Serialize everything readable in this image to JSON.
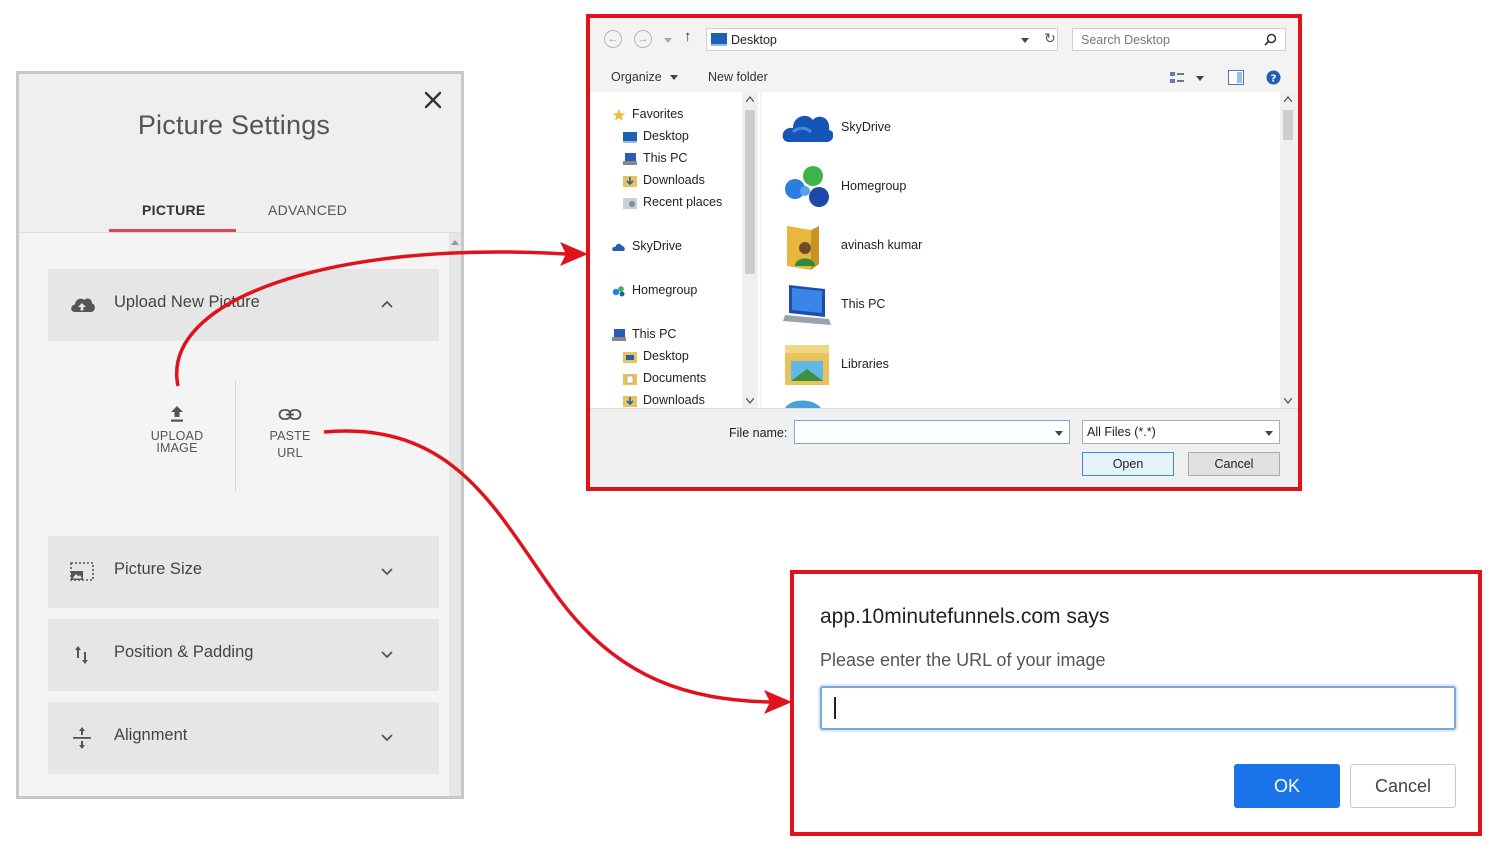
{
  "picture_settings": {
    "title": "Picture Settings",
    "tabs": [
      {
        "label": "PICTURE",
        "active": true
      },
      {
        "label": "ADVANCED",
        "active": false
      }
    ],
    "sections": [
      {
        "label": "Upload New Picture",
        "icon": "cloud-upload-icon",
        "expanded": true
      },
      {
        "label": "Picture Size",
        "icon": "picture-size-icon",
        "expanded": false
      },
      {
        "label": "Position & Padding",
        "icon": "position-arrows-icon",
        "expanded": false
      },
      {
        "label": "Alignment",
        "icon": "alignment-icon",
        "expanded": false
      }
    ],
    "upload_options": [
      {
        "line1": "UPLOAD",
        "line2": "IMAGE",
        "icon": "upload-arrow-icon"
      },
      {
        "line1": "PASTE",
        "line2": "URL",
        "icon": "link-icon"
      }
    ]
  },
  "file_dialog": {
    "address": "Desktop",
    "search_placeholder": "Search Desktop",
    "toolbar": {
      "organize": "Organize",
      "new_folder": "New folder"
    },
    "nav_pane": [
      {
        "label": "Favorites",
        "level": 0,
        "icon": "star-icon"
      },
      {
        "label": "Desktop",
        "level": 1,
        "icon": "desktop-icon"
      },
      {
        "label": "This PC",
        "level": 1,
        "icon": "computer-icon"
      },
      {
        "label": "Downloads",
        "level": 1,
        "icon": "downloads-folder-icon"
      },
      {
        "label": "Recent places",
        "level": 1,
        "icon": "recent-places-icon"
      },
      {
        "label": "SkyDrive",
        "level": 0,
        "icon": "skydrive-icon"
      },
      {
        "label": "Homegroup",
        "level": 0,
        "icon": "homegroup-icon"
      },
      {
        "label": "This PC",
        "level": 0,
        "icon": "computer-icon"
      },
      {
        "label": "Desktop",
        "level": 1,
        "icon": "desktop-icon"
      },
      {
        "label": "Documents",
        "level": 1,
        "icon": "documents-folder-icon"
      },
      {
        "label": "Downloads",
        "level": 1,
        "icon": "downloads-folder-icon"
      }
    ],
    "items": [
      {
        "label": "SkyDrive",
        "icon": "skydrive-cloud-icon"
      },
      {
        "label": "Homegroup",
        "icon": "homegroup-icon"
      },
      {
        "label": "avinash kumar",
        "icon": "user-folder-icon"
      },
      {
        "label": "This PC",
        "icon": "computer-icon"
      },
      {
        "label": "Libraries",
        "icon": "libraries-folder-icon"
      }
    ],
    "file_name_label": "File name:",
    "file_name_value": "",
    "filter": "All Files (*.*)",
    "open_label": "Open",
    "cancel_label": "Cancel"
  },
  "url_prompt": {
    "title": "app.10minutefunnels.com says",
    "message": "Please enter the URL of your image",
    "input_value": "",
    "ok_label": "OK",
    "cancel_label": "Cancel"
  },
  "colors": {
    "highlight_red": "#e0131c",
    "tab_underline": "#e8424c",
    "ok_blue": "#1a73e8"
  }
}
